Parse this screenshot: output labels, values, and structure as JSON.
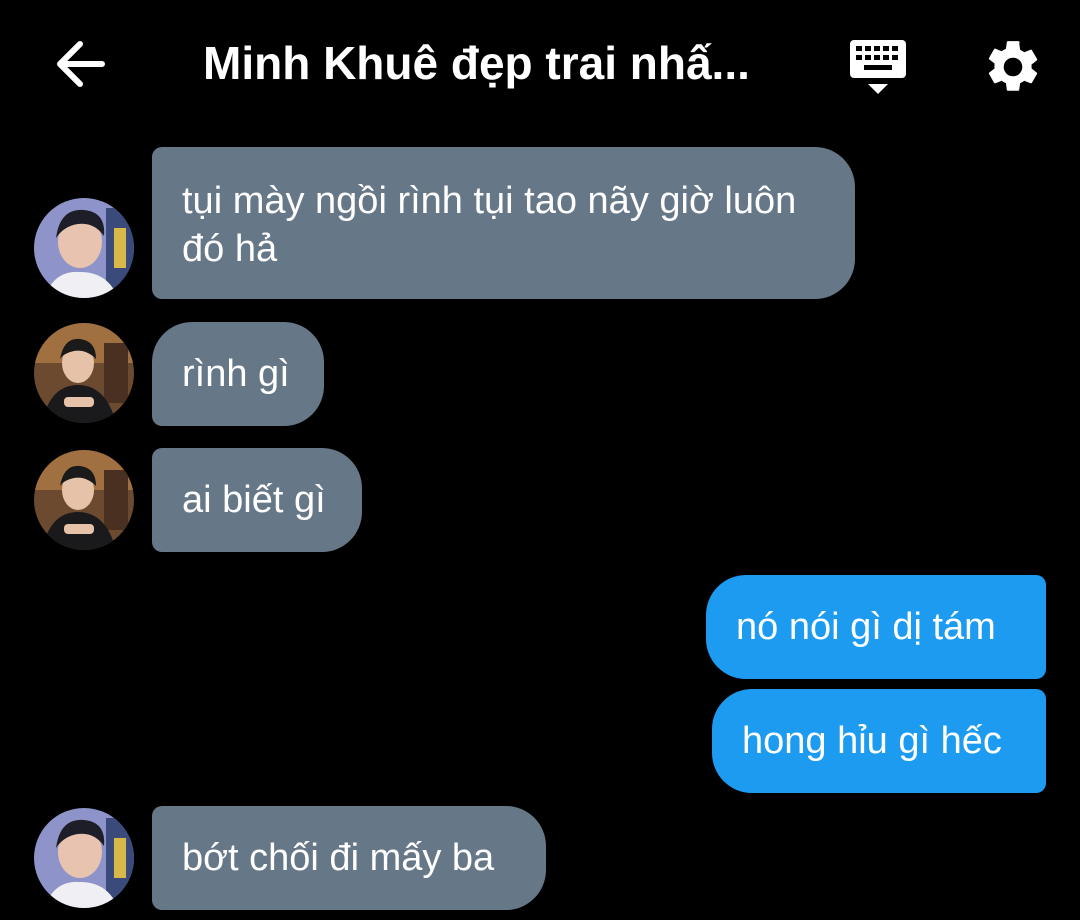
{
  "header": {
    "title": "Minh Khuê đẹp trai nhấ...",
    "back_icon": "arrow-left-icon",
    "keyboard_icon": "keyboard-icon",
    "settings_icon": "gear-icon"
  },
  "colors": {
    "background": "#000000",
    "incoming_bubble": "#667788",
    "outgoing_bubble": "#1d9bf0",
    "text": "#ffffff"
  },
  "messages": [
    {
      "direction": "incoming",
      "text": "tụi mày ngồi rình tụi tao nãy giờ luôn đó hả"
    },
    {
      "direction": "incoming",
      "text": "rình gì"
    },
    {
      "direction": "incoming",
      "text": "ai biết gì"
    },
    {
      "direction": "outgoing",
      "text": "nó nói gì dị tám"
    },
    {
      "direction": "outgoing",
      "text": "hong hỉu gì hếc"
    },
    {
      "direction": "incoming",
      "text": "bớt chối đi mấy ba"
    }
  ]
}
